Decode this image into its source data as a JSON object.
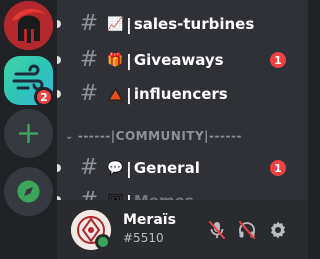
{
  "servers": [
    {
      "name": "spartan-server",
      "icon": "spartan-helmet-icon",
      "color": "#b3282d"
    },
    {
      "name": "wind-server",
      "icon": "wind-icon",
      "badge": "2"
    },
    {
      "name": "add-server",
      "icon": "plus-icon",
      "color": "#3ba55d"
    },
    {
      "name": "explore-servers",
      "icon": "compass-icon",
      "color": "#3ba55d"
    }
  ],
  "channels": [
    {
      "hash": "#",
      "emoji": "📈",
      "label": "sales-turbines",
      "unread": true,
      "badge": ""
    },
    {
      "hash": "#",
      "emoji": "🎁",
      "label": "Giveaways",
      "unread": true,
      "badge": "1"
    },
    {
      "hash": "#",
      "emoji": "🔺",
      "label": "influencers",
      "unread": true,
      "badge": ""
    },
    {
      "hash": "#",
      "emoji": "💬",
      "label": "General",
      "unread": true,
      "badge": "1"
    },
    {
      "hash": "#",
      "emoji": "🖼",
      "label": "Memes",
      "unread": true,
      "badge": ""
    }
  ],
  "category": {
    "label": "------|COMMUNITY|------"
  },
  "user": {
    "name": "Meraïs",
    "tag": "#5510",
    "status_color": "#3ba55d"
  },
  "controls": [
    {
      "name": "mute-microphone",
      "icon": "microphone-muted-icon"
    },
    {
      "name": "deafen",
      "icon": "headphones-muted-icon"
    },
    {
      "name": "user-settings",
      "icon": "gear-icon"
    }
  ],
  "colors": {
    "badge": "#ed4245",
    "rail": "#202225",
    "sidebar": "#2f3136",
    "panel": "#292b2f"
  }
}
